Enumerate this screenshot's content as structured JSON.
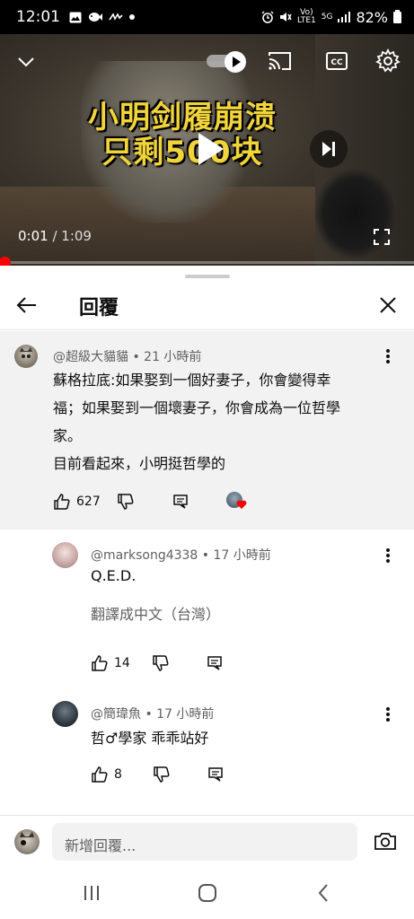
{
  "status_bar": {
    "time": "12:01",
    "network_top": "Vo)",
    "network_bottom": "LTE1",
    "signal_label": "5G",
    "battery": "82%"
  },
  "video": {
    "caption_line1": "小明剑履崩溃",
    "caption_line2": "只剩500块",
    "current_time": "0:01",
    "separator": " / ",
    "duration": "1:09",
    "progress_fraction": 0.01
  },
  "sheet": {
    "title": "回覆"
  },
  "parent_comment": {
    "author": "@超級大貓貓",
    "time": " • 21 小時前",
    "text_line1": "蘇格拉底:如果娶到一個好妻子，你會變得幸",
    "text_line2": "福；如果娶到一個壞妻子，你會成為一位哲學",
    "text_line3": "家。",
    "text_line4": "目前看起來，小明挺哲學的",
    "likes": "627"
  },
  "replies": [
    {
      "author": "@marksong4338",
      "time": " • 17 小時前",
      "text": "Q.E.D.",
      "translate": "翻譯成中文（台灣）",
      "likes": "14"
    },
    {
      "author": "@簡瑋魚",
      "time": " • 17 小時前",
      "text": "哲♂學家 乖乖站好",
      "likes": "8"
    }
  ],
  "reply_bar": {
    "placeholder": "新增回覆..."
  },
  "icons": {
    "chevron": "chevron-down-icon",
    "autoplay": "autoplay-toggle-icon",
    "cast": "cast-icon",
    "cc": "closed-captions-icon",
    "settings": "gear-icon",
    "play": "play-icon",
    "next": "skip-next-icon",
    "fullscreen": "fullscreen-icon",
    "back": "arrow-back-icon",
    "close": "close-icon",
    "like": "thumbs-up-icon",
    "dislike": "thumbs-down-icon",
    "reply": "reply-icon",
    "more": "more-vert-icon",
    "camera": "camera-icon"
  },
  "colors": {
    "accent_red": "#ff0000",
    "caption_yellow": "#f1d43a",
    "highlight_bg": "#f2f2f2"
  }
}
